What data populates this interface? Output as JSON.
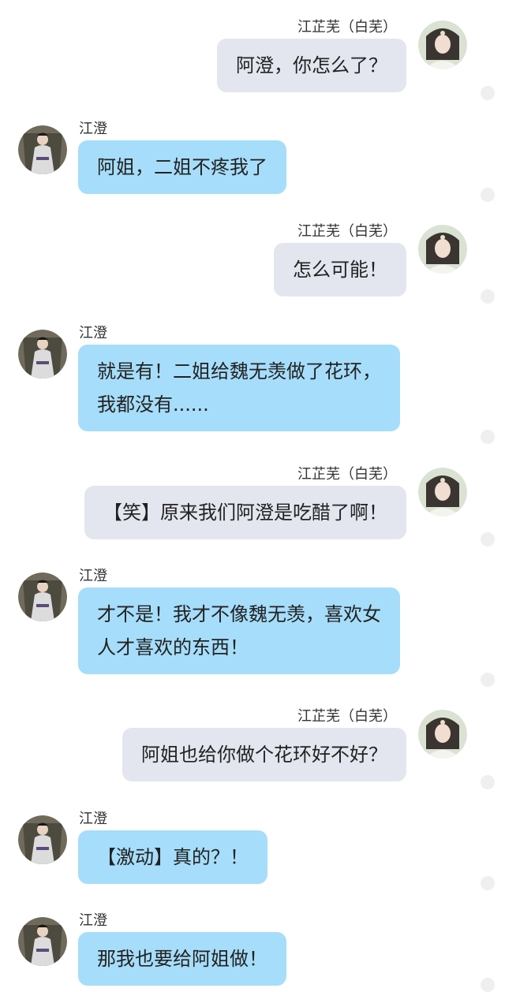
{
  "names": {
    "sister": "江芷芜（白芜）",
    "brother": "江澄"
  },
  "messages": [
    {
      "side": "right",
      "text": "阿澄，你怎么了？"
    },
    {
      "side": "left",
      "text": "阿姐，二姐不疼我了"
    },
    {
      "side": "right",
      "text": "怎么可能！"
    },
    {
      "side": "left",
      "text": "就是有！二姐给魏无羡做了花环，\n我都没有......"
    },
    {
      "side": "right",
      "text": "【笑】原来我们阿澄是吃醋了啊！"
    },
    {
      "side": "left",
      "text": "才不是！我才不像魏无羡，喜欢女\n人才喜欢的东西！"
    },
    {
      "side": "right",
      "text": "阿姐也给你做个花环好不好？"
    },
    {
      "side": "left",
      "text": "【激动】真的？！"
    },
    {
      "side": "left",
      "text": "那我也要给阿姐做！"
    }
  ]
}
